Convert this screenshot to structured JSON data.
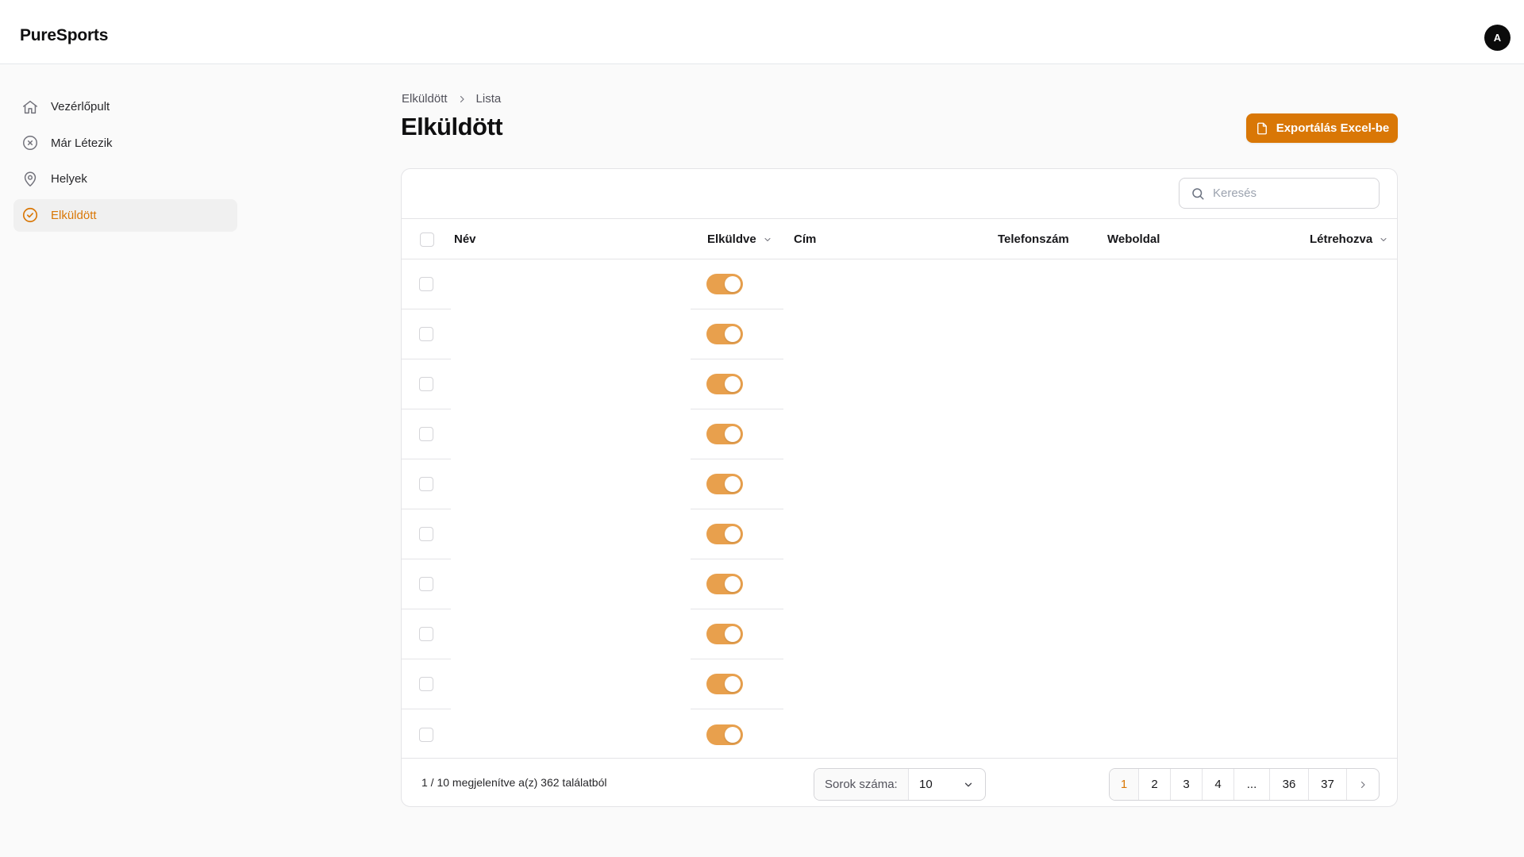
{
  "app": {
    "brand": "PureSports",
    "avatar_initial": "A"
  },
  "sidebar": {
    "items": [
      {
        "label": "Vezérlőpult",
        "icon": "home-icon",
        "active": false
      },
      {
        "label": "Már Létezik",
        "icon": "x-circle-icon",
        "active": false
      },
      {
        "label": "Helyek",
        "icon": "map-pin-icon",
        "active": false
      },
      {
        "label": "Elküldött",
        "icon": "check-circle-icon",
        "active": true
      }
    ]
  },
  "breadcrumb": [
    "Elküldött",
    "Lista"
  ],
  "page": {
    "title": "Elküldött",
    "export_label": "Exportálás Excel-be"
  },
  "search": {
    "placeholder": "Keresés",
    "value": ""
  },
  "table": {
    "columns": [
      "Név",
      "Elküldve",
      "Cím",
      "Telefonszám",
      "Weboldal",
      "Létrehozva"
    ],
    "rows": [
      {
        "nev": "",
        "elkuldve": true,
        "cim": "",
        "telefonszam": "",
        "weboldal": "",
        "letrehozva": ""
      },
      {
        "nev": "",
        "elkuldve": true,
        "cim": "",
        "telefonszam": "",
        "weboldal": "",
        "letrehozva": ""
      },
      {
        "nev": "",
        "elkuldve": true,
        "cim": "",
        "telefonszam": "",
        "weboldal": "",
        "letrehozva": ""
      },
      {
        "nev": "",
        "elkuldve": true,
        "cim": "",
        "telefonszam": "",
        "weboldal": "",
        "letrehozva": ""
      },
      {
        "nev": "",
        "elkuldve": true,
        "cim": "",
        "telefonszam": "",
        "weboldal": "",
        "letrehozva": ""
      },
      {
        "nev": "",
        "elkuldve": true,
        "cim": "",
        "telefonszam": "",
        "weboldal": "",
        "letrehozva": ""
      },
      {
        "nev": "",
        "elkuldve": true,
        "cim": "",
        "telefonszam": "",
        "weboldal": "",
        "letrehozva": ""
      },
      {
        "nev": "",
        "elkuldve": true,
        "cim": "",
        "telefonszam": "",
        "weboldal": "",
        "letrehozva": ""
      },
      {
        "nev": "",
        "elkuldve": true,
        "cim": "",
        "telefonszam": "",
        "weboldal": "",
        "letrehozva": ""
      },
      {
        "nev": "",
        "elkuldve": true,
        "cim": "",
        "telefonszam": "",
        "weboldal": "",
        "letrehozva": ""
      }
    ]
  },
  "footer": {
    "summary": "1 / 10 megjelenítve a(z) 362 találatból",
    "per_page_label": "Sorok száma:",
    "per_page_value": "10",
    "pages": [
      "1",
      "2",
      "3",
      "4",
      "...",
      "36",
      "37"
    ],
    "current_page": "1"
  },
  "colors": {
    "accent": "#d97706",
    "toggle_on": "#e8a04d"
  }
}
